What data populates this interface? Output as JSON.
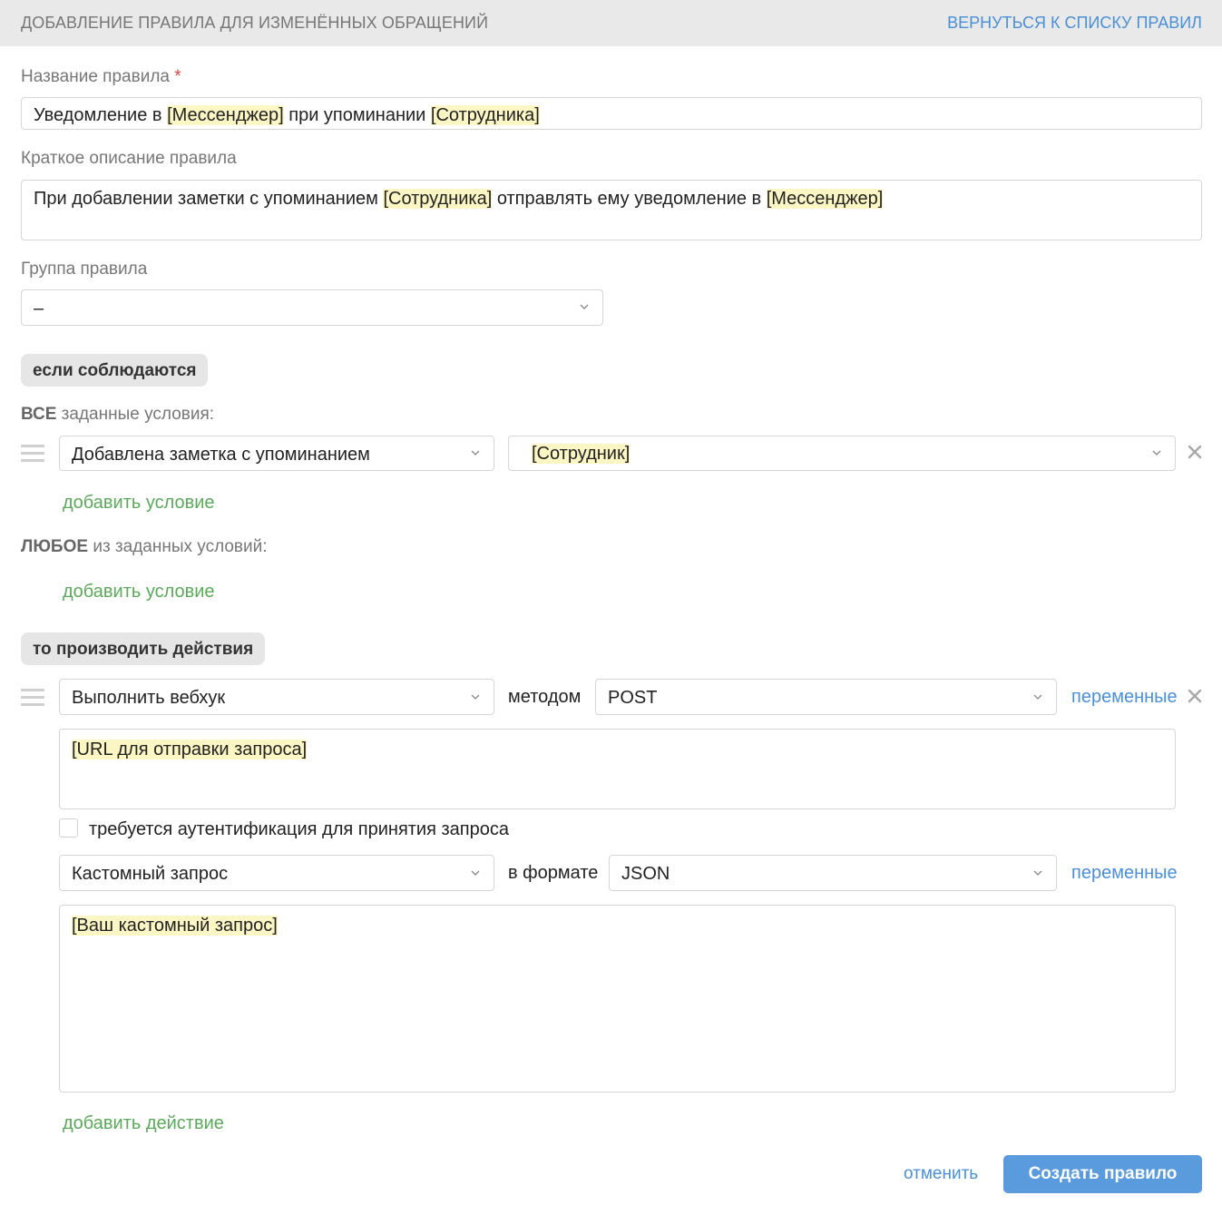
{
  "header": {
    "title": "ДОБАВЛЕНИЕ ПРАВИЛА ДЛЯ ИЗМЕНЁННЫХ ОБРАЩЕНИЙ",
    "back_link": "ВЕРНУТЬСЯ К СПИСКУ ПРАВИЛ"
  },
  "rule_name": {
    "label": "Название правила",
    "required_mark": "*",
    "value_parts": [
      "Уведомление в ",
      "[Мессенджер]",
      " при упоминании ",
      "[Сотрудника]"
    ]
  },
  "description": {
    "label": "Краткое описание правила",
    "value_parts": [
      "При добавлении заметки с упоминанием ",
      "[Сотрудника]",
      " отправлять ему уведомление в ",
      "[Мессенджер]"
    ]
  },
  "group": {
    "label": "Группа правила",
    "value": "–"
  },
  "conditions": {
    "pill": "если соблюдаются",
    "all_label_bold": "ВСЕ",
    "all_label_rest": " заданные условия:",
    "all_rows": [
      {
        "type": "Добавлена заметка с упоминанием",
        "value": "[Сотрудник]"
      }
    ],
    "add_condition_all": "добавить условие",
    "any_label_bold": "ЛЮБОЕ",
    "any_label_rest": " из заданных условий:",
    "add_condition_any": "добавить условие"
  },
  "actions": {
    "pill": "то производить действия",
    "row": {
      "type": "Выполнить вебхук",
      "method_label": "методом",
      "method": "POST",
      "variables_link": "переменные",
      "url_placeholder": "[URL для отправки запроса]",
      "auth_label": "требуется аутентификация для принятия запроса",
      "auth_checked": false,
      "request_type": "Кастомный запрос",
      "format_label": "в формате",
      "format": "JSON",
      "variables_link_2": "переменные",
      "body_placeholder": "[Ваш кастомный запрос]"
    },
    "add_action": "добавить действие"
  },
  "footer": {
    "cancel": "отменить",
    "submit": "Создать правило"
  },
  "colors": {
    "link_blue": "#4a90d9",
    "link_green": "#5aaa5a",
    "highlight": "#fbf6c4",
    "submit_bg": "#5a9bde",
    "required_red": "#e0453a"
  }
}
